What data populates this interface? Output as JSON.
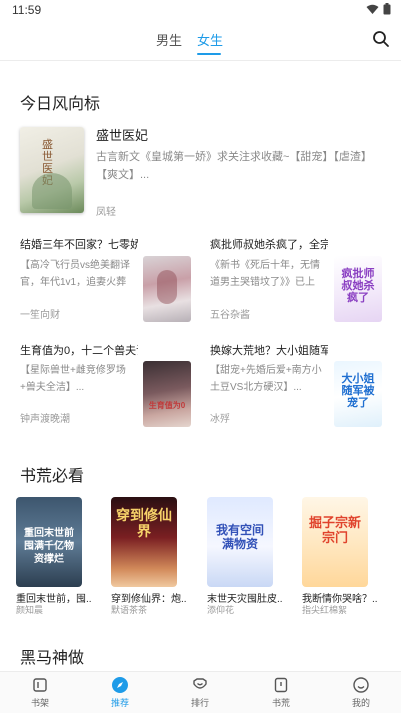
{
  "status": {
    "time": "11:59"
  },
  "tabs": {
    "male": "男生",
    "female": "女生"
  },
  "sections": {
    "trending": "今日风向标",
    "must_read": "书荒必看",
    "dark_horse": "黑马神做"
  },
  "featured": {
    "title": "盛世医妃",
    "desc": "古言新文《皇城第一娇》求关注求收藏~【甜宠】【虐渣】【爽文】...",
    "author": "凤轻",
    "cover_text": "盛世医妃"
  },
  "list": [
    {
      "title": "结婚三年不回家？七零娇...",
      "desc": "【高冷飞行员vs绝美翻译官，年代1v1，追妻火葬场】...",
      "author": "一笙向财"
    },
    {
      "title": "疯批师叔她杀疯了，全宗...",
      "desc": "《新书《死后十年，无情道男主哭错坟了》》已上线，欢...",
      "author": "五谷杂酱",
      "cover_text": "疯批师叔她杀疯了"
    },
    {
      "title": "生育值为0，十二个兽夫请...",
      "desc": "【星际兽世+雌竞修罗场+兽夫全洁】...",
      "author": "钟声渡晚潮",
      "cover_text": "生育值为0"
    },
    {
      "title": "换嫁大荒地？大小姐随军...",
      "desc": "【甜宠+先婚后爱+南方小土豆VS北方硬汉】...",
      "author": "冰殍",
      "cover_text": "大小姐随军被宠了"
    }
  ],
  "grid": [
    {
      "title": "重回末世前，囤...",
      "author": "颜知晨",
      "cover_text": "重回末世前 囤满千亿物资撑烂"
    },
    {
      "title": "穿到修仙界：炮...",
      "author": "默语茶茶",
      "cover_text": "穿到修仙界"
    },
    {
      "title": "末世天灾囤肚皮...",
      "author": "添仰花",
      "cover_text": "我有空间满物资"
    },
    {
      "title": "我断情你哭啥？...",
      "author": "指尖红棉絮",
      "cover_text": "掘子宗新宗门"
    }
  ],
  "nav": [
    {
      "label": "书架",
      "icon": "bookshelf-icon"
    },
    {
      "label": "推荐",
      "icon": "compass-icon"
    },
    {
      "label": "排行",
      "icon": "ranking-icon"
    },
    {
      "label": "书荒",
      "icon": "book-icon"
    },
    {
      "label": "我的",
      "icon": "profile-icon"
    }
  ],
  "colors": {
    "accent": "#1e9be8",
    "text": "#222222",
    "muted": "#8a8a8a"
  }
}
